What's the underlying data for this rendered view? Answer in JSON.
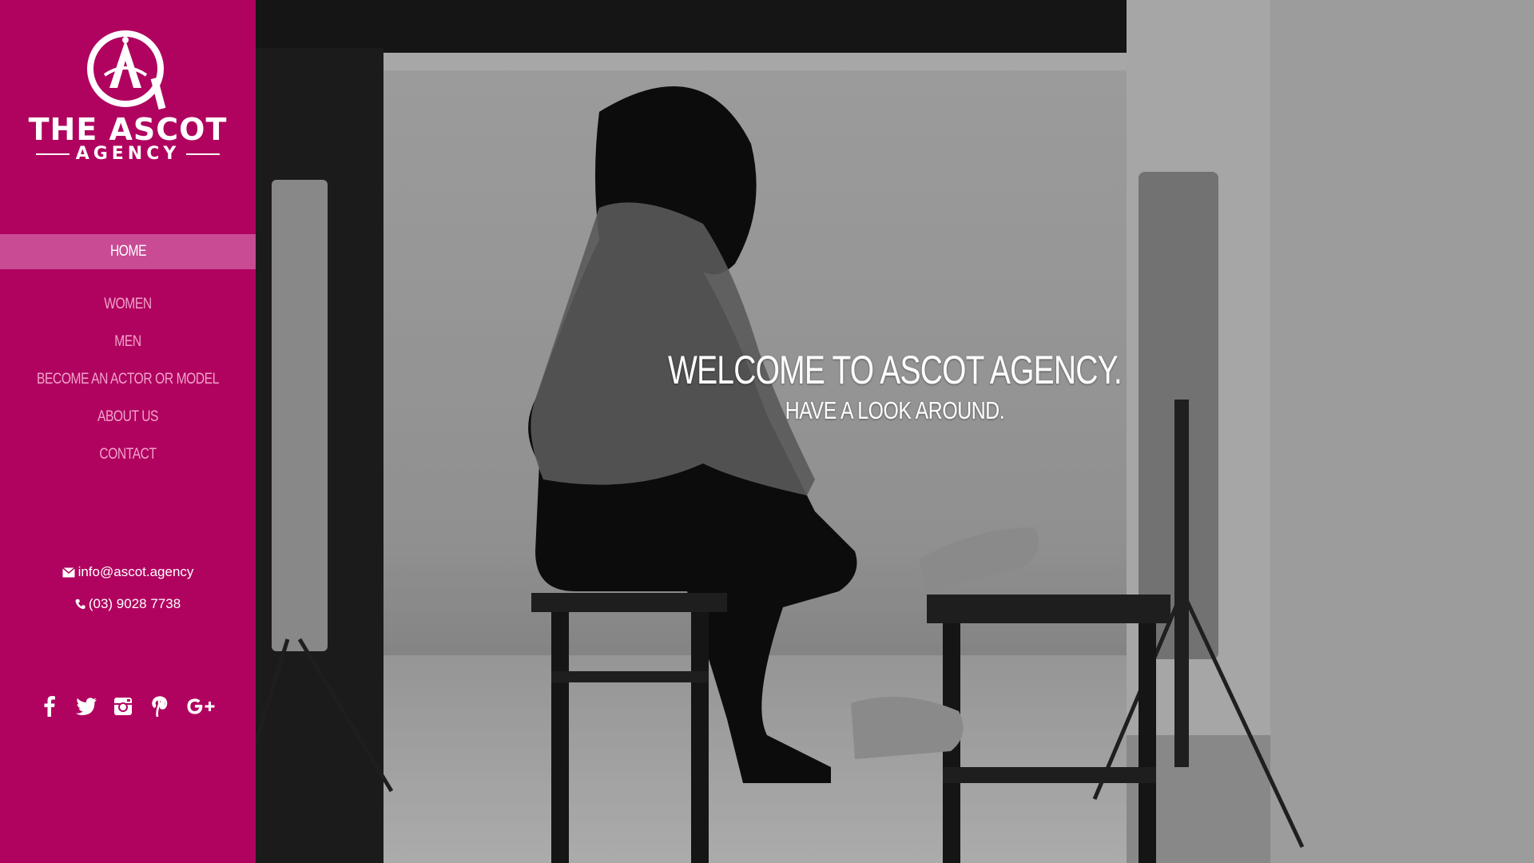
{
  "brand": {
    "name_line1": "THE ASCOT",
    "name_line2": "AGENCY",
    "accent_color": "#b0035f",
    "active_nav_color": "#c94b94"
  },
  "nav": {
    "items": [
      {
        "label": "HOME",
        "active": true
      },
      {
        "label": "WOMEN",
        "active": false
      },
      {
        "label": "MEN",
        "active": false
      },
      {
        "label": "BECOME AN ACTOR OR MODEL",
        "active": false
      },
      {
        "label": "ABOUT US",
        "active": false
      },
      {
        "label": "CONTACT",
        "active": false
      }
    ]
  },
  "contact": {
    "email": "info@ascot.agency",
    "email_icon": "envelope-icon",
    "phone": "(03) 9028 7738",
    "phone_icon": "phone-icon"
  },
  "social": {
    "icons": [
      "facebook-icon",
      "twitter-icon",
      "instagram-icon",
      "pinterest-icon",
      "google-plus-icon"
    ]
  },
  "hero": {
    "title": "WELCOME TO ASCOT AGENCY.",
    "subtitle": "HAVE A LOOK AROUND."
  }
}
